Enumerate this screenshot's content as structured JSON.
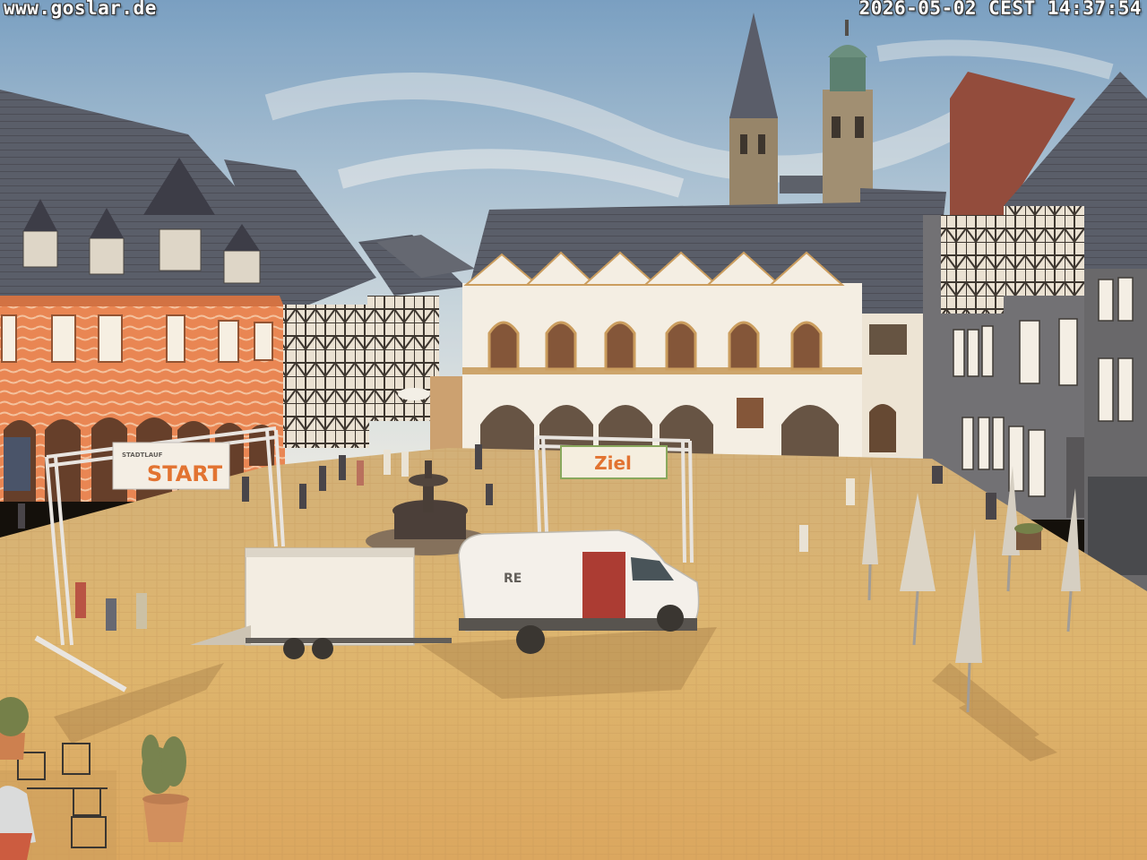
{
  "overlay": {
    "site_url": "www.goslar.de",
    "timestamp": "2026-05-02 CEST 14:37:54"
  },
  "scene": {
    "start_banner": "START",
    "start_banner_small": "STADTLAUF",
    "finish_banner": "Ziel",
    "van_text": "RE"
  },
  "colors": {
    "sky_top": "#7fa9cf",
    "sky_bottom": "#dde6ea",
    "paving": "#d9b36e",
    "hall_white": "#f4f2ec",
    "roof_slate": "#4b5366",
    "hotel_orange": "#e07a45"
  }
}
